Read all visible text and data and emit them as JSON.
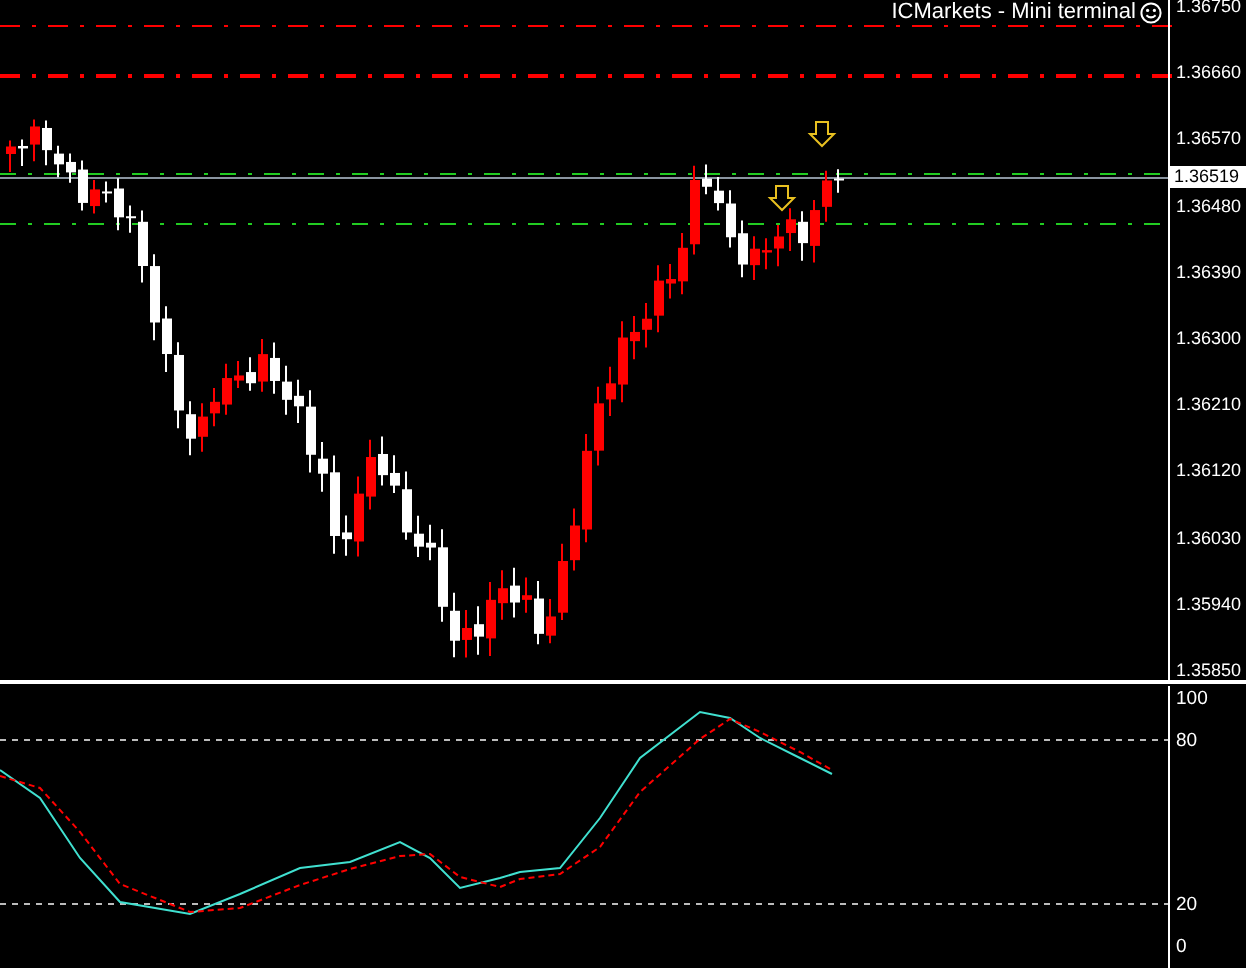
{
  "chart": {
    "title": "ICMarkets - Mini terminal",
    "price_axis": [
      "1.36750",
      "1.36660",
      "1.36570",
      "1.36480",
      "1.36390",
      "1.36300",
      "1.36210",
      "1.36120",
      "1.36030",
      "1.35940",
      "1.35850"
    ],
    "current_price": "1.36519"
  },
  "indicator": {
    "axis": [
      "100",
      "80",
      "20",
      "0"
    ]
  }
}
